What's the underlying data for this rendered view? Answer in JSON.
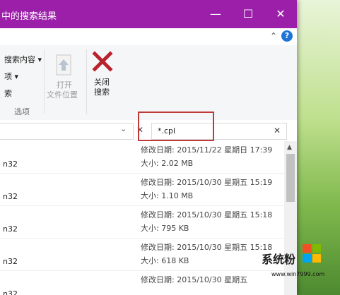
{
  "window": {
    "title": "中的搜索结果",
    "minimize_glyph": "—",
    "maximize_glyph": "☐",
    "close_glyph": "✕"
  },
  "ribbon": {
    "options_label": "搜索内容 ▾",
    "item2_label": "项 ▾",
    "item3_label": "索",
    "open_line1": "打开",
    "open_line2": "文件位置",
    "close_line1": "关闭",
    "close_line2": "搜索",
    "group_label": "选项",
    "collapse_glyph": "⌃",
    "help_glyph": "?"
  },
  "address": {
    "chevron": "⌄",
    "clear": "✕"
  },
  "search": {
    "value": "*.cpl",
    "clear": "✕"
  },
  "files": [
    {
      "name": "n32",
      "date": "修改日期: 2015/11/22 星期日 17:39",
      "size": "大小: 2.02 MB"
    },
    {
      "name": "n32",
      "date": "修改日期: 2015/10/30 星期五 15:19",
      "size": "大小: 1.10 MB"
    },
    {
      "name": "n32",
      "date": "修改日期: 2015/10/30 星期五 15:18",
      "size": "大小: 795 KB"
    },
    {
      "name": "n32",
      "date": "修改日期: 2015/10/30 星期五 15:18",
      "size": "大小: 618 KB"
    },
    {
      "name": "n32",
      "date": "修改日期: 2015/10/30 星期五",
      "size": ""
    }
  ],
  "scroll": {
    "up_glyph": "▲"
  },
  "watermark": {
    "brand": "系统粉",
    "url": "www.win7999.com",
    "windows_colors": [
      "#f25022",
      "#7fba00",
      "#00a4ef",
      "#ffb900"
    ]
  },
  "colors": {
    "titlebar": "#9b1fa8",
    "highlight": "#c0393a",
    "close_x": "#b8232d"
  }
}
